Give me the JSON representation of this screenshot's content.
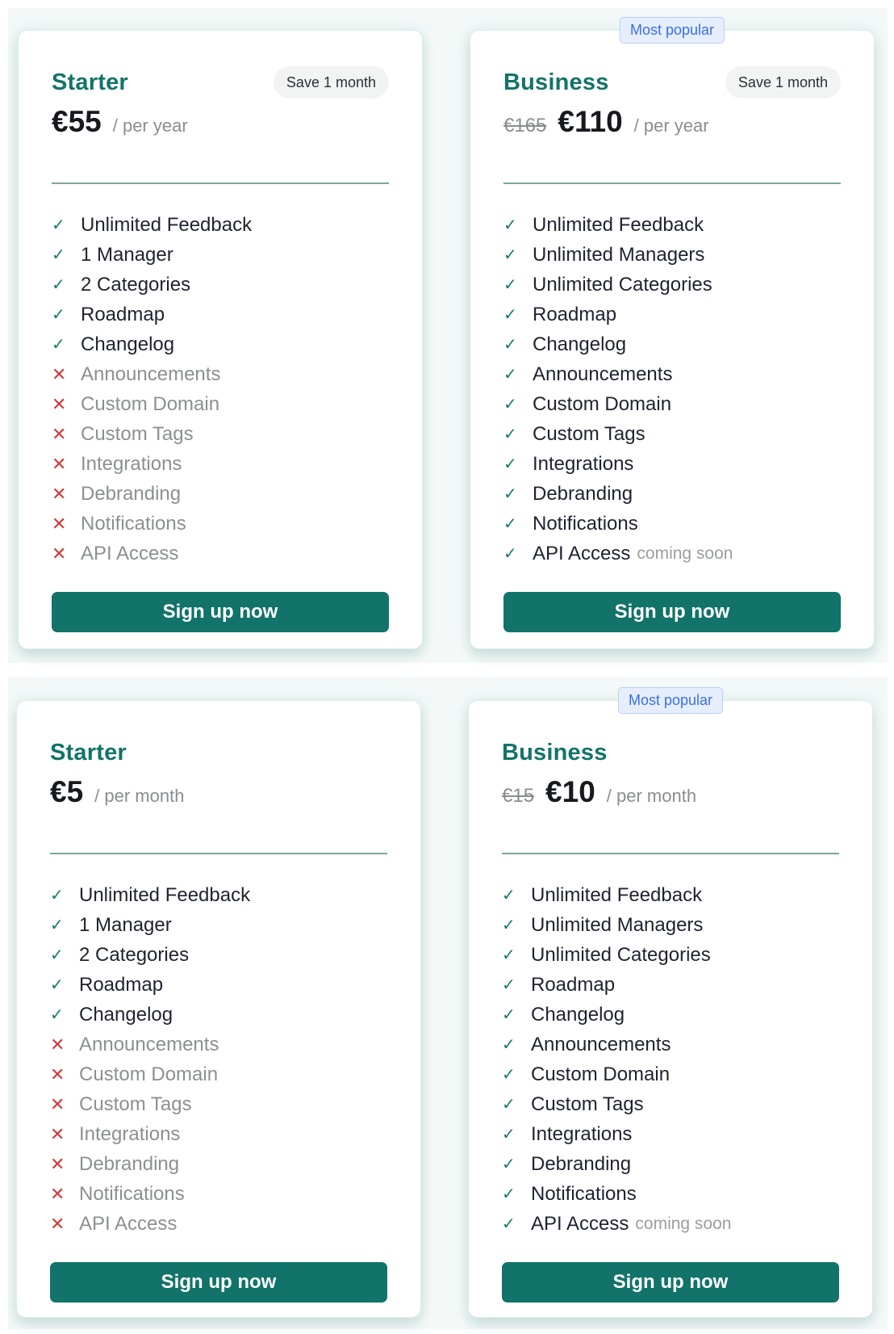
{
  "yearly": {
    "starter": {
      "name": "Starter",
      "badge": "Save 1 month",
      "price": "€55",
      "period": "/ per year",
      "cta": "Sign up now",
      "features": [
        {
          "label": "Unlimited Feedback",
          "included": true
        },
        {
          "label": "1 Manager",
          "included": true
        },
        {
          "label": "2 Categories",
          "included": true
        },
        {
          "label": "Roadmap",
          "included": true
        },
        {
          "label": "Changelog",
          "included": true
        },
        {
          "label": "Announcements",
          "included": false
        },
        {
          "label": "Custom Domain",
          "included": false
        },
        {
          "label": "Custom Tags",
          "included": false
        },
        {
          "label": "Integrations",
          "included": false
        },
        {
          "label": "Debranding",
          "included": false
        },
        {
          "label": "Notifications",
          "included": false
        },
        {
          "label": "API Access",
          "included": false
        }
      ]
    },
    "business": {
      "ribbon": "Most popular",
      "name": "Business",
      "badge": "Save 1 month",
      "old_price": "€165",
      "price": "€110",
      "period": "/ per year",
      "cta": "Sign up now",
      "features": [
        {
          "label": "Unlimited Feedback",
          "included": true
        },
        {
          "label": "Unlimited Managers",
          "included": true
        },
        {
          "label": "Unlimited Categories",
          "included": true
        },
        {
          "label": "Roadmap",
          "included": true
        },
        {
          "label": "Changelog",
          "included": true
        },
        {
          "label": "Announcements",
          "included": true
        },
        {
          "label": "Custom Domain",
          "included": true
        },
        {
          "label": "Custom Tags",
          "included": true
        },
        {
          "label": "Integrations",
          "included": true
        },
        {
          "label": "Debranding",
          "included": true
        },
        {
          "label": "Notifications",
          "included": true
        },
        {
          "label": "API Access",
          "included": true,
          "note": "coming soon"
        }
      ]
    }
  },
  "monthly": {
    "starter": {
      "name": "Starter",
      "price": "€5",
      "period": "/ per month",
      "cta": "Sign up now",
      "features": [
        {
          "label": "Unlimited Feedback",
          "included": true
        },
        {
          "label": "1 Manager",
          "included": true
        },
        {
          "label": "2 Categories",
          "included": true
        },
        {
          "label": "Roadmap",
          "included": true
        },
        {
          "label": "Changelog",
          "included": true
        },
        {
          "label": "Announcements",
          "included": false
        },
        {
          "label": "Custom Domain",
          "included": false
        },
        {
          "label": "Custom Tags",
          "included": false
        },
        {
          "label": "Integrations",
          "included": false
        },
        {
          "label": "Debranding",
          "included": false
        },
        {
          "label": "Notifications",
          "included": false
        },
        {
          "label": "API Access",
          "included": false
        }
      ]
    },
    "business": {
      "ribbon": "Most popular",
      "name": "Business",
      "old_price": "€15",
      "price": "€10",
      "period": "/ per month",
      "cta": "Sign up now",
      "features": [
        {
          "label": "Unlimited Feedback",
          "included": true
        },
        {
          "label": "Unlimited Managers",
          "included": true
        },
        {
          "label": "Unlimited Categories",
          "included": true
        },
        {
          "label": "Roadmap",
          "included": true
        },
        {
          "label": "Changelog",
          "included": true
        },
        {
          "label": "Announcements",
          "included": true
        },
        {
          "label": "Custom Domain",
          "included": true
        },
        {
          "label": "Custom Tags",
          "included": true
        },
        {
          "label": "Integrations",
          "included": true
        },
        {
          "label": "Debranding",
          "included": true
        },
        {
          "label": "Notifications",
          "included": true
        },
        {
          "label": "API Access",
          "included": true,
          "note": "coming soon"
        }
      ]
    }
  },
  "icons": {
    "included": "check-icon",
    "excluded": "x-icon"
  },
  "colors": {
    "brand": "#117369",
    "excluded": "#d33a3a",
    "popular": "#3a6ee8"
  }
}
